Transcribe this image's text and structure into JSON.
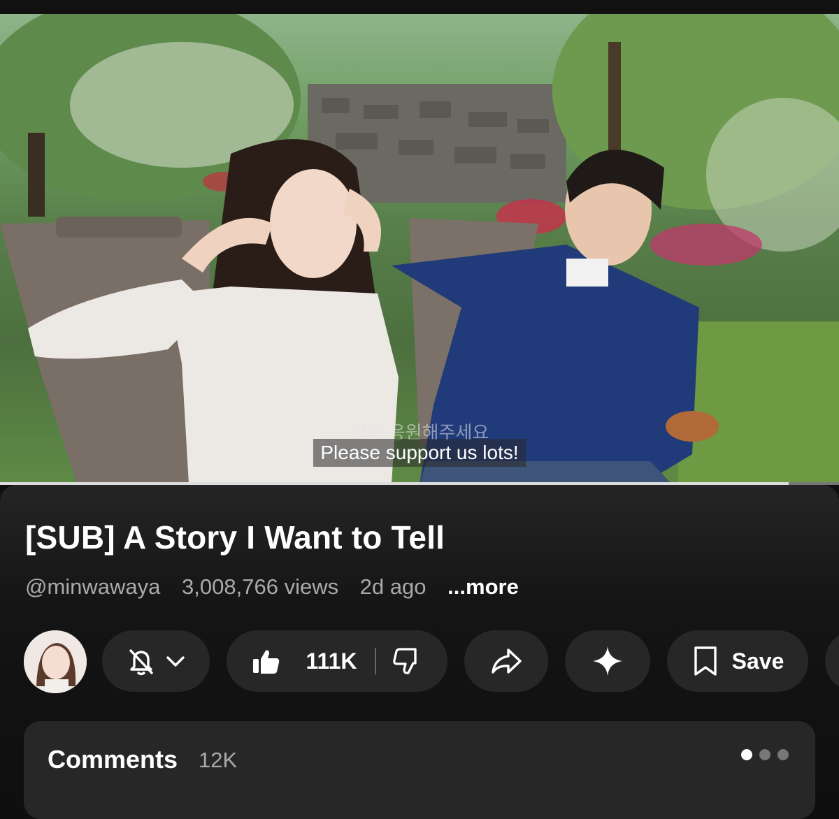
{
  "video": {
    "subtitle_ko": "많이 응원해주세요",
    "subtitle_en": "Please support us lots!",
    "progress": 0.94
  },
  "details": {
    "title": "[SUB] A Story I Want to Tell",
    "channel": "@minwawaya",
    "views": "3,008,766 views",
    "age": "2d ago",
    "more": "...more"
  },
  "actions": {
    "like_count": "111K",
    "save_label": "Save",
    "icons": [
      "bell-off-icon",
      "chevron-down-icon",
      "thumb-up-icon",
      "thumb-down-icon",
      "share-icon",
      "sparkle-icon",
      "bookmark-icon"
    ]
  },
  "comments": {
    "title": "Comments",
    "count": "12K"
  }
}
